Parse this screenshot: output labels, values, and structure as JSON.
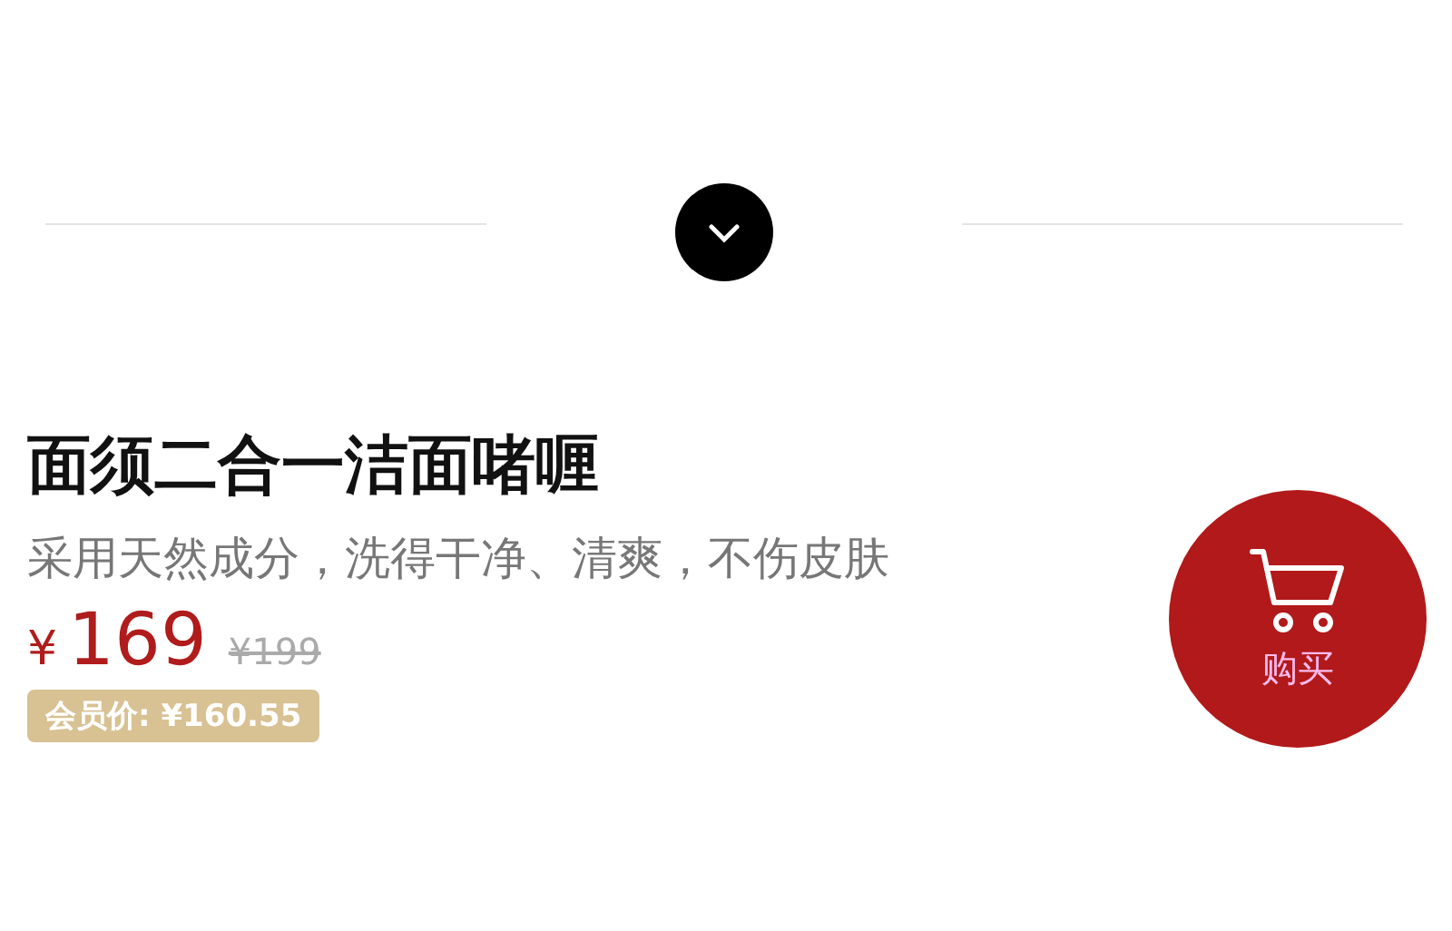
{
  "product": {
    "title": "面须二合一洁面啫喱",
    "subtitle": "采用天然成分，洗得干净、清爽，不伤皮肤",
    "currency": "¥",
    "price": "169",
    "original_price": "¥199",
    "member_price": "会员价: ¥160.55"
  },
  "buy_button": {
    "label": "购买"
  }
}
